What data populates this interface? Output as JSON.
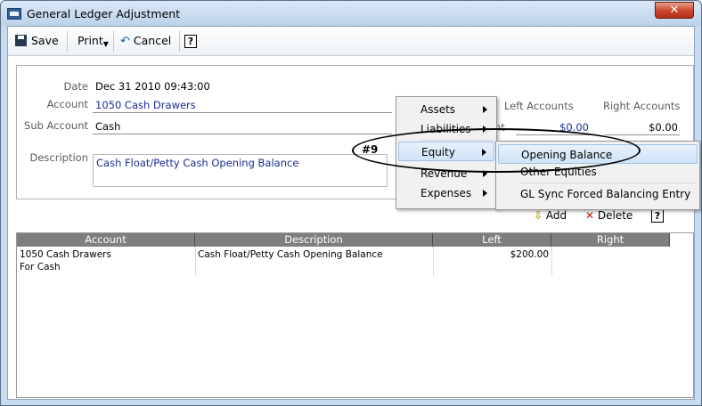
{
  "window": {
    "title": "General Ledger Adjustment",
    "close_glyph": "✕"
  },
  "toolbar": {
    "save": "Save",
    "print": "Print",
    "cancel": "Cancel",
    "help": "?"
  },
  "form": {
    "date_label": "Date",
    "date_value": "Dec 31 2010 09:43:00",
    "account_label": "Account",
    "account_value": "1050 Cash Drawers",
    "sub_account_label": "Sub Account",
    "sub_account_value": "Cash",
    "description_label": "Description",
    "description_value": "Cash Float/Petty Cash Opening Balance",
    "left_accounts_label": "Left Accounts",
    "right_accounts_label": "Right Accounts",
    "left_amount": "$0.00",
    "right_amount": "$0.00",
    "amount_partial": "nt"
  },
  "entry_bar": {
    "add": "Add",
    "delete": "Delete",
    "help": "?"
  },
  "grid": {
    "columns": [
      "Account",
      "Description",
      "Left",
      "Right"
    ],
    "rows": [
      {
        "account_line1": "1050 Cash Drawers",
        "account_line2": "For Cash",
        "description": "Cash Float/Petty Cash Opening Balance",
        "left": "$200.00",
        "right": ""
      }
    ]
  },
  "context_menu": {
    "items": [
      "Assets",
      "Liabilities",
      "Equity",
      "Revenue",
      "Expenses"
    ],
    "highlighted": "Equity"
  },
  "submenu": {
    "items": [
      "Opening Balance",
      "Other Equities",
      "GL Sync Forced Balancing Entry"
    ],
    "highlighted": "Opening Balance"
  },
  "annotation": {
    "label": "#9"
  }
}
